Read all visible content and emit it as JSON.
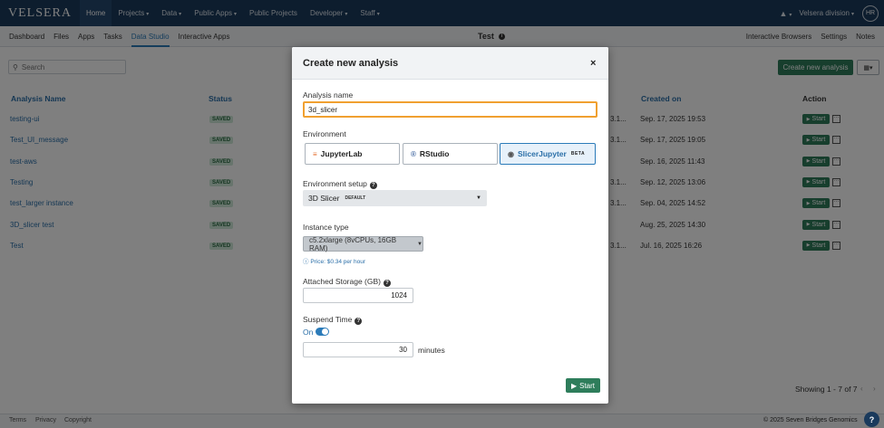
{
  "topnav": {
    "logo": "VELSERA",
    "items": [
      {
        "label": "Home",
        "active": true,
        "dropdown": false
      },
      {
        "label": "Projects",
        "active": false,
        "dropdown": true
      },
      {
        "label": "Data",
        "active": false,
        "dropdown": true
      },
      {
        "label": "Public Apps",
        "active": false,
        "dropdown": true
      },
      {
        "label": "Public Projects",
        "active": false,
        "dropdown": false
      },
      {
        "label": "Developer",
        "active": false,
        "dropdown": true
      },
      {
        "label": "Staff",
        "active": false,
        "dropdown": true
      }
    ],
    "user_name": "Velsera division",
    "avatar_initials": "HR"
  },
  "subnav": {
    "left": [
      "Dashboard",
      "Files",
      "Apps",
      "Tasks",
      "Data Studio",
      "Interactive Apps"
    ],
    "active": "Data Studio",
    "project_title": "Test",
    "right": [
      "Interactive Browsers",
      "Settings",
      "Notes"
    ]
  },
  "page": {
    "search_placeholder": "Search",
    "create_button": "Create new analysis",
    "view_button_caret": "▾",
    "columns": {
      "name": "Analysis Name",
      "status": "Status",
      "created": "Created on",
      "action": "Action"
    },
    "rows": [
      {
        "name": "testing-ui",
        "status": "SAVED",
        "partial": "3.1...",
        "created": "Sep. 17, 2025 19:53",
        "action": "Start"
      },
      {
        "name": "Test_UI_message",
        "status": "SAVED",
        "partial": "3.1...",
        "created": "Sep. 17, 2025 19:05",
        "action": "Start"
      },
      {
        "name": "test-aws",
        "status": "SAVED",
        "partial": "",
        "created": "Sep. 16, 2025 11:43",
        "action": "Start"
      },
      {
        "name": "Testing",
        "status": "SAVED",
        "partial": "3.1...",
        "created": "Sep. 12, 2025 13:06",
        "action": "Start"
      },
      {
        "name": "test_larger instance",
        "status": "SAVED",
        "partial": "3.1...",
        "created": "Sep. 04, 2025 14:52",
        "action": "Start"
      },
      {
        "name": "3D_slicer test",
        "status": "SAVED",
        "partial": "",
        "created": "Aug. 25, 2025 14:30",
        "action": "Start"
      },
      {
        "name": "Test",
        "status": "SAVED",
        "partial": "3.1...",
        "created": "Jul. 16, 2025 16:26",
        "action": "Start"
      }
    ],
    "showing": "Showing 1 - 7 of 7"
  },
  "footer": {
    "links": [
      "Terms",
      "Privacy",
      "Copyright"
    ],
    "copyright": "© 2025 Seven Bridges Genomics",
    "help": "?"
  },
  "modal": {
    "title": "Create new analysis",
    "close": "×",
    "analysis_name_label": "Analysis name",
    "analysis_name_value": "3d_slicer",
    "environment_label": "Environment",
    "environments": [
      {
        "label": "JupyterLab",
        "icon": "jupyter-icon",
        "selected": false
      },
      {
        "label": "RStudio",
        "icon": "rstudio-icon",
        "selected": false
      },
      {
        "label": "SlicerJupyter",
        "icon": "slicer-icon",
        "selected": true,
        "tag": "BETA"
      }
    ],
    "environment_setup_label": "Environment setup",
    "environment_setup_value": "3D Slicer",
    "environment_setup_tag": "DEFAULT",
    "instance_type_label": "Instance type",
    "instance_type_value": "c5.2xlarge (8vCPUs, 16GB RAM)",
    "price_note": "Price: $0.34 per hour",
    "storage_label": "Attached Storage (GB)",
    "storage_value": "1024",
    "suspend_label": "Suspend Time",
    "suspend_state": "On",
    "suspend_minutes": "30",
    "minutes_label": "minutes",
    "start_button": "Start"
  },
  "colors": {
    "nav_bg": "#1a3a5c",
    "accent_blue": "#2b7bb9",
    "start_green": "#2e7d5b",
    "focus_orange": "#f0a030"
  }
}
